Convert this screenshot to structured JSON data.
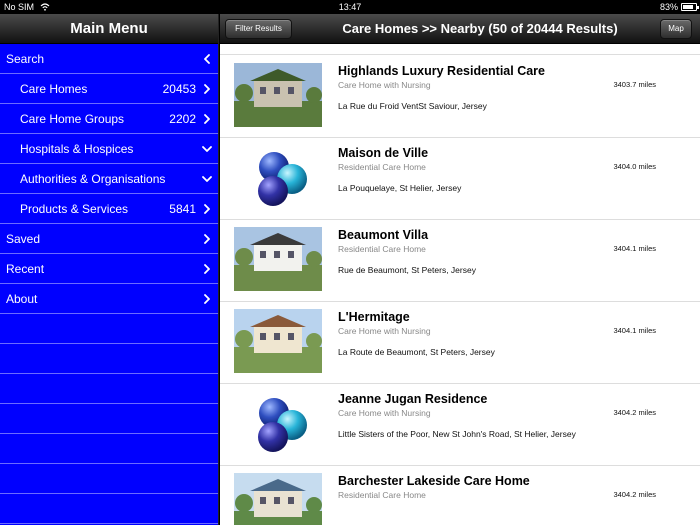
{
  "status": {
    "carrier": "No SIM",
    "time": "13:47",
    "battery": "83%",
    "battery_level": 0.83
  },
  "sidebar": {
    "title": "Main Menu",
    "items": [
      {
        "label": "Search",
        "count": "",
        "sub": false,
        "chevron": "chevron-left-icon"
      },
      {
        "label": "Care Homes",
        "count": "20453",
        "sub": true,
        "chevron": "chevron-right-icon"
      },
      {
        "label": "Care Home Groups",
        "count": "2202",
        "sub": true,
        "chevron": "chevron-right-icon"
      },
      {
        "label": "Hospitals & Hospices",
        "count": "",
        "sub": true,
        "chevron": "chevron-down-icon"
      },
      {
        "label": "Authorities & Organisations",
        "count": "",
        "sub": true,
        "chevron": "chevron-down-icon"
      },
      {
        "label": "Products & Services",
        "count": "5841",
        "sub": true,
        "chevron": "chevron-right-icon"
      },
      {
        "label": "Saved",
        "count": "",
        "sub": false,
        "chevron": "chevron-right-icon"
      },
      {
        "label": "Recent",
        "count": "",
        "sub": false,
        "chevron": "chevron-right-icon"
      },
      {
        "label": "About",
        "count": "",
        "sub": false,
        "chevron": "chevron-right-icon"
      }
    ]
  },
  "navbar": {
    "filter_label": "Filter Results",
    "title": "Care Homes >> Nearby (50 of 20444 Results)",
    "map_label": "Map"
  },
  "results": [
    {
      "name": "Highlands Luxury Residential Care",
      "type": "Care Home with Nursing",
      "address": "La Rue du Froid VentSt Saviour, Jersey",
      "distance": "3403.7 miles",
      "image": "garden-photo"
    },
    {
      "name": "Maison de Ville",
      "type": "Residential Care Home",
      "address": "La Pouquelaye, St Helier, Jersey",
      "distance": "3404.0 miles",
      "image": "bubbles-logo"
    },
    {
      "name": "Beaumont Villa",
      "type": "Residential Care Home",
      "address": "Rue de Beaumont, St Peters, Jersey",
      "distance": "3404.1 miles",
      "image": "house-photo"
    },
    {
      "name": "L'Hermitage",
      "type": "Care Home with Nursing",
      "address": "La Route de Beaumont, St Peters, Jersey",
      "distance": "3404.1 miles",
      "image": "building-photo"
    },
    {
      "name": "Jeanne Jugan Residence",
      "type": "Care Home with Nursing",
      "address": "Little Sisters of the Poor, New St John's Road, St Helier, Jersey",
      "distance": "3404.2 miles",
      "image": "bubbles-logo"
    },
    {
      "name": "Barchester Lakeside Care Home",
      "type": "Residential Care Home",
      "address": "",
      "distance": "3404.2 miles",
      "image": "lake-photo"
    }
  ]
}
